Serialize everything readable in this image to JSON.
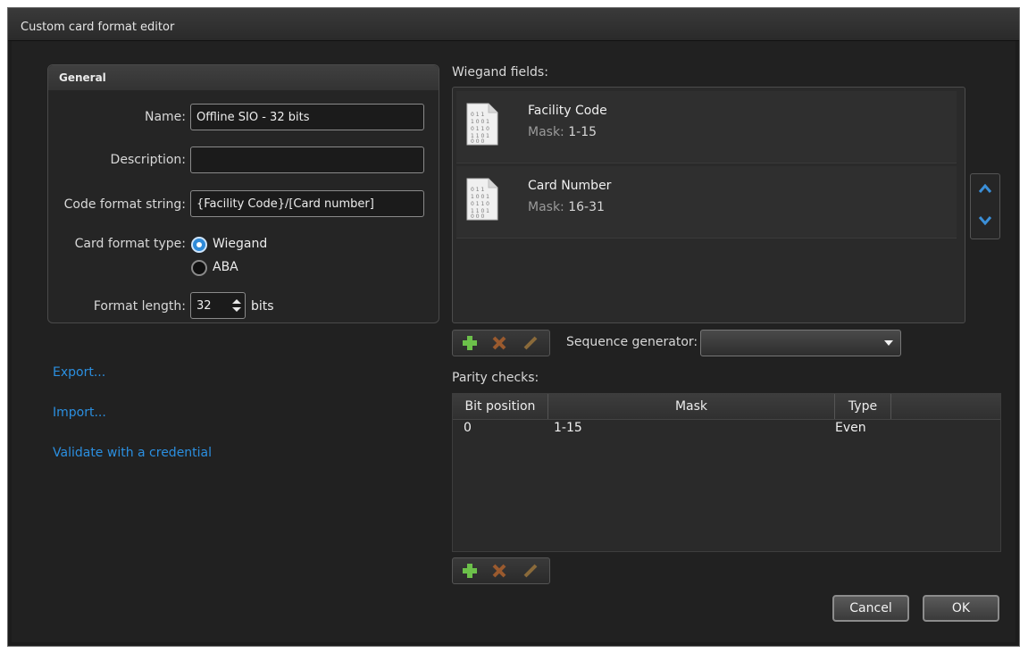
{
  "window": {
    "title": "Custom card format editor"
  },
  "general": {
    "header": "General",
    "name_label": "Name:",
    "name_value": "Offline SIO - 32 bits",
    "description_label": "Description:",
    "description_value": "",
    "code_format_label": "Code format string:",
    "code_format_value": "{Facility Code}/[Card number]",
    "card_format_type_label": "Card format type:",
    "card_format_options": [
      "Wiegand",
      "ABA"
    ],
    "card_format_selected": "Wiegand",
    "format_length_label": "Format length:",
    "format_length_value": "32",
    "format_length_unit": "bits"
  },
  "links": {
    "export": "Export...",
    "import": "Import...",
    "validate": "Validate with a credential"
  },
  "wiegand": {
    "label": "Wiegand fields:",
    "fields": [
      {
        "name": "Facility Code",
        "mask_label": "Mask:",
        "mask": "1-15"
      },
      {
        "name": "Card Number",
        "mask_label": "Mask:",
        "mask": "16-31"
      }
    ]
  },
  "sequence_generator": {
    "label": "Sequence generator:",
    "value": ""
  },
  "parity": {
    "label": "Parity checks:",
    "columns": [
      "Bit position",
      "Mask",
      "Type"
    ],
    "rows": [
      {
        "bit_position": "0",
        "mask": "1-15",
        "type": "Even"
      }
    ]
  },
  "buttons": {
    "cancel": "Cancel",
    "ok": "OK"
  },
  "colors": {
    "accent": "#2e8ad8",
    "link": "#2b8fe0",
    "add_icon": "#6cc04a",
    "delete_icon": "#c46a2a"
  }
}
